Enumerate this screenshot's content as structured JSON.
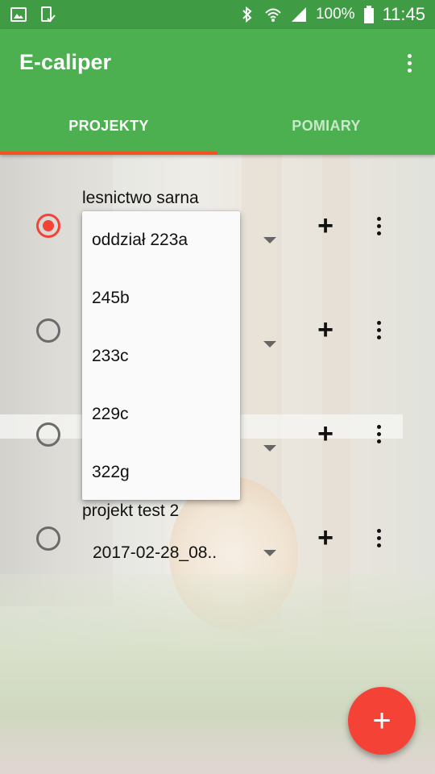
{
  "status_bar": {
    "battery": "100%",
    "time": "11:45"
  },
  "app": {
    "title": "E-caliper"
  },
  "tabs": [
    {
      "label": "PROJEKTY",
      "active": true
    },
    {
      "label": "POMIARY",
      "active": false
    }
  ],
  "projects": [
    {
      "title": "lesnictwo sarna",
      "selected": true,
      "value": ""
    },
    {
      "title": "",
      "selected": false,
      "value": ""
    },
    {
      "title": "",
      "selected": false,
      "value": ""
    },
    {
      "title": "projekt test 2",
      "selected": false,
      "value": "2017-02-28_08.."
    }
  ],
  "dropdown": {
    "items": [
      "oddział 223a",
      "245b",
      "233c",
      "229c",
      "322g"
    ]
  },
  "fab": {
    "label": "+"
  },
  "icons": {
    "row_add": "+",
    "accent": "#f44336",
    "primary": "#4caf50"
  }
}
